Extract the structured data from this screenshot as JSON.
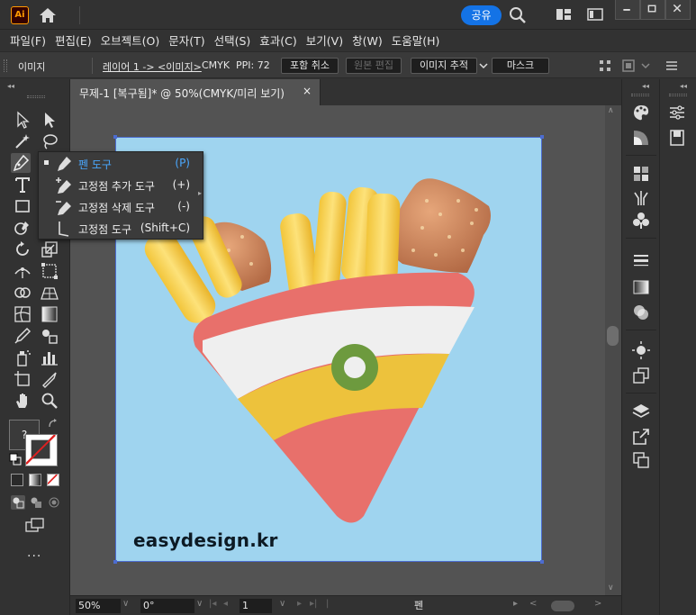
{
  "app": {
    "logo_text": "Ai"
  },
  "titlebar": {
    "share_label": "공유"
  },
  "menu": [
    "파일(F)",
    "편집(E)",
    "오브젝트(O)",
    "문자(T)",
    "선택(S)",
    "효과(C)",
    "보기(V)",
    "창(W)",
    "도움말(H)"
  ],
  "controlbar": {
    "object_type": "이미지",
    "layer_path": "레이어 1 -> <이미지>",
    "color_mode": "CMYK",
    "ppi": "PPI: 72",
    "btn_unembed": "포함 취소",
    "btn_edit_original": "원본 편집",
    "btn_image_trace": "이미지 추적",
    "btn_mask": "마스크"
  },
  "document": {
    "tab_title": "무제-1 [복구됨]* @ 50%(CMYK/미리 보기)",
    "close_glyph": "×"
  },
  "artwork": {
    "watermark": "easydesign.kr"
  },
  "flyout": {
    "items": [
      {
        "label": "펜 도구",
        "shortcut": "(P)",
        "icon": "pen-icon",
        "selected": true
      },
      {
        "label": "고정점 추가 도구",
        "shortcut": "(+)",
        "icon": "add-anchor-icon",
        "selected": false
      },
      {
        "label": "고정점 삭제 도구",
        "shortcut": "(-)",
        "icon": "delete-anchor-icon",
        "selected": false
      },
      {
        "label": "고정점 도구",
        "shortcut": "(Shift+C)",
        "icon": "anchor-point-icon",
        "selected": false
      }
    ]
  },
  "toolbar": {
    "fill_label": "?",
    "more_tools": "..."
  },
  "statusbar": {
    "zoom": "50%",
    "rotate": "0°",
    "artboard_num": "1",
    "current_tool": "펜"
  },
  "colors": {
    "accent": "#1473e6",
    "bg": "#323232",
    "canvas": "#535353",
    "artboard": "#9fd4ef",
    "selection": "#4c6cd0",
    "flyout_selected": "#4aa8ff"
  }
}
